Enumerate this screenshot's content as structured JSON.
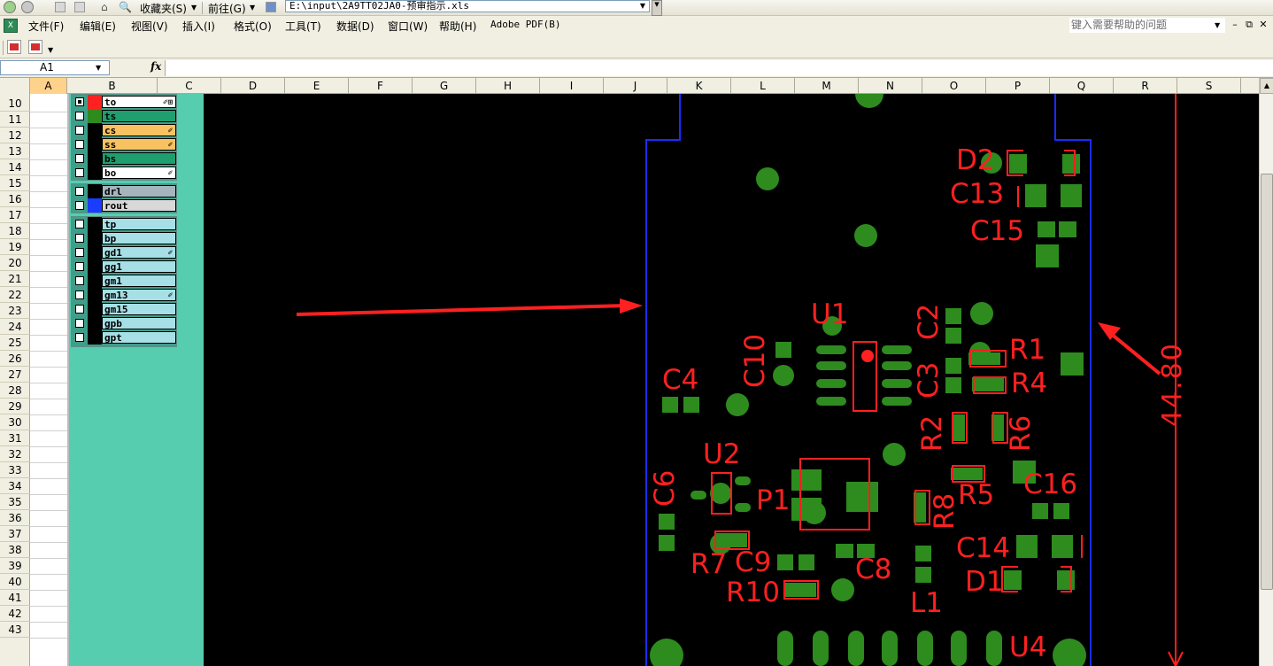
{
  "nav": {
    "favorites": "收藏夹(S)",
    "go": "前往(G)",
    "address": "E:\\input\\2A9TT02JA0-预审指示.xls"
  },
  "menu": {
    "items": [
      "文件(F)",
      "编辑(E)",
      "视图(V)",
      "插入(I)",
      "格式(O)",
      "工具(T)",
      "数据(D)",
      "窗口(W)",
      "帮助(H)",
      "Adobe PDF(B)"
    ],
    "help_placeholder": "键入需要帮助的问题"
  },
  "formula_bar": {
    "name_box": "A1",
    "fx": "fx",
    "value": ""
  },
  "columns": [
    "A",
    "B",
    "C",
    "D",
    "E",
    "F",
    "G",
    "H",
    "I",
    "J",
    "K",
    "L",
    "M",
    "N",
    "O",
    "P",
    "Q",
    "R",
    "S"
  ],
  "rows": [
    "10",
    "11",
    "12",
    "13",
    "14",
    "15",
    "16",
    "17",
    "18",
    "19",
    "20",
    "21",
    "22",
    "23",
    "24",
    "25",
    "26",
    "27",
    "28",
    "29",
    "30",
    "31",
    "32",
    "33",
    "34",
    "35",
    "36",
    "37",
    "38",
    "39",
    "40",
    "41",
    "42",
    "43"
  ],
  "layers": {
    "group1": [
      {
        "name": "to",
        "bg": "#ffffff",
        "swatch": "#ff2020",
        "checked": true,
        "mark": "✐⊞"
      },
      {
        "name": "ts",
        "bg": "#1f9e6e",
        "swatch": "#2e8b1e",
        "checked": false,
        "mark": ""
      },
      {
        "name": "cs",
        "bg": "#f9c261",
        "swatch": "#000000",
        "checked": false,
        "mark": "✐"
      },
      {
        "name": "ss",
        "bg": "#f9c261",
        "swatch": "#000000",
        "checked": false,
        "mark": "✐"
      },
      {
        "name": "bs",
        "bg": "#1f9e6e",
        "swatch": "#000000",
        "checked": false,
        "mark": ""
      },
      {
        "name": "bo",
        "bg": "#ffffff",
        "swatch": "#000000",
        "checked": false,
        "mark": "✐"
      }
    ],
    "group2": [
      {
        "name": "drl",
        "bg": "#a5b5bd",
        "swatch": "#000000",
        "checked": false,
        "mark": ""
      },
      {
        "name": "rout",
        "bg": "#d8d8d8",
        "swatch": "#1a3cff",
        "checked": false,
        "mark": ""
      }
    ],
    "group3": [
      {
        "name": "tp",
        "bg": "#a7dfe6",
        "swatch": "#000000",
        "checked": false,
        "mark": ""
      },
      {
        "name": "bp",
        "bg": "#a7dfe6",
        "swatch": "#000000",
        "checked": false,
        "mark": ""
      },
      {
        "name": "gd1",
        "bg": "#a7dfe6",
        "swatch": "#000000",
        "checked": false,
        "mark": "✐"
      },
      {
        "name": "gg1",
        "bg": "#a7dfe6",
        "swatch": "#000000",
        "checked": false,
        "mark": ""
      },
      {
        "name": "gm1",
        "bg": "#a7dfe6",
        "swatch": "#000000",
        "checked": false,
        "mark": ""
      },
      {
        "name": "gm13",
        "bg": "#a7dfe6",
        "swatch": "#000000",
        "checked": false,
        "mark": "✐"
      },
      {
        "name": "gm15",
        "bg": "#a7dfe6",
        "swatch": "#000000",
        "checked": false,
        "mark": ""
      },
      {
        "name": "gpb",
        "bg": "#a7dfe6",
        "swatch": "#000000",
        "checked": false,
        "mark": ""
      },
      {
        "name": "gpt",
        "bg": "#a7dfe6",
        "swatch": "#000000",
        "checked": false,
        "mark": ""
      }
    ]
  },
  "pcb": {
    "dimension": "44.80",
    "labels": {
      "D2": "D2",
      "C13": "C13",
      "C15": "C15",
      "U1": "U1",
      "C2": "C2",
      "R1": "R1",
      "C10": "C10",
      "C3": "C3",
      "R4": "R4",
      "C4": "C4",
      "R2": "R2",
      "R6": "R6",
      "U2": "U2",
      "C6": "C6",
      "P1": "P1",
      "R5": "R5",
      "R8": "R8",
      "C16": "C16",
      "R7": "R7",
      "C9": "C9",
      "C8": "C8",
      "C14": "C14",
      "R10": "R10",
      "D1": "D1",
      "L1": "L1",
      "U4": "U4"
    },
    "colors": {
      "silk": "#ff2020",
      "copper": "#2e8b1e",
      "outline": "#1a2cff",
      "board": "#000000"
    }
  }
}
